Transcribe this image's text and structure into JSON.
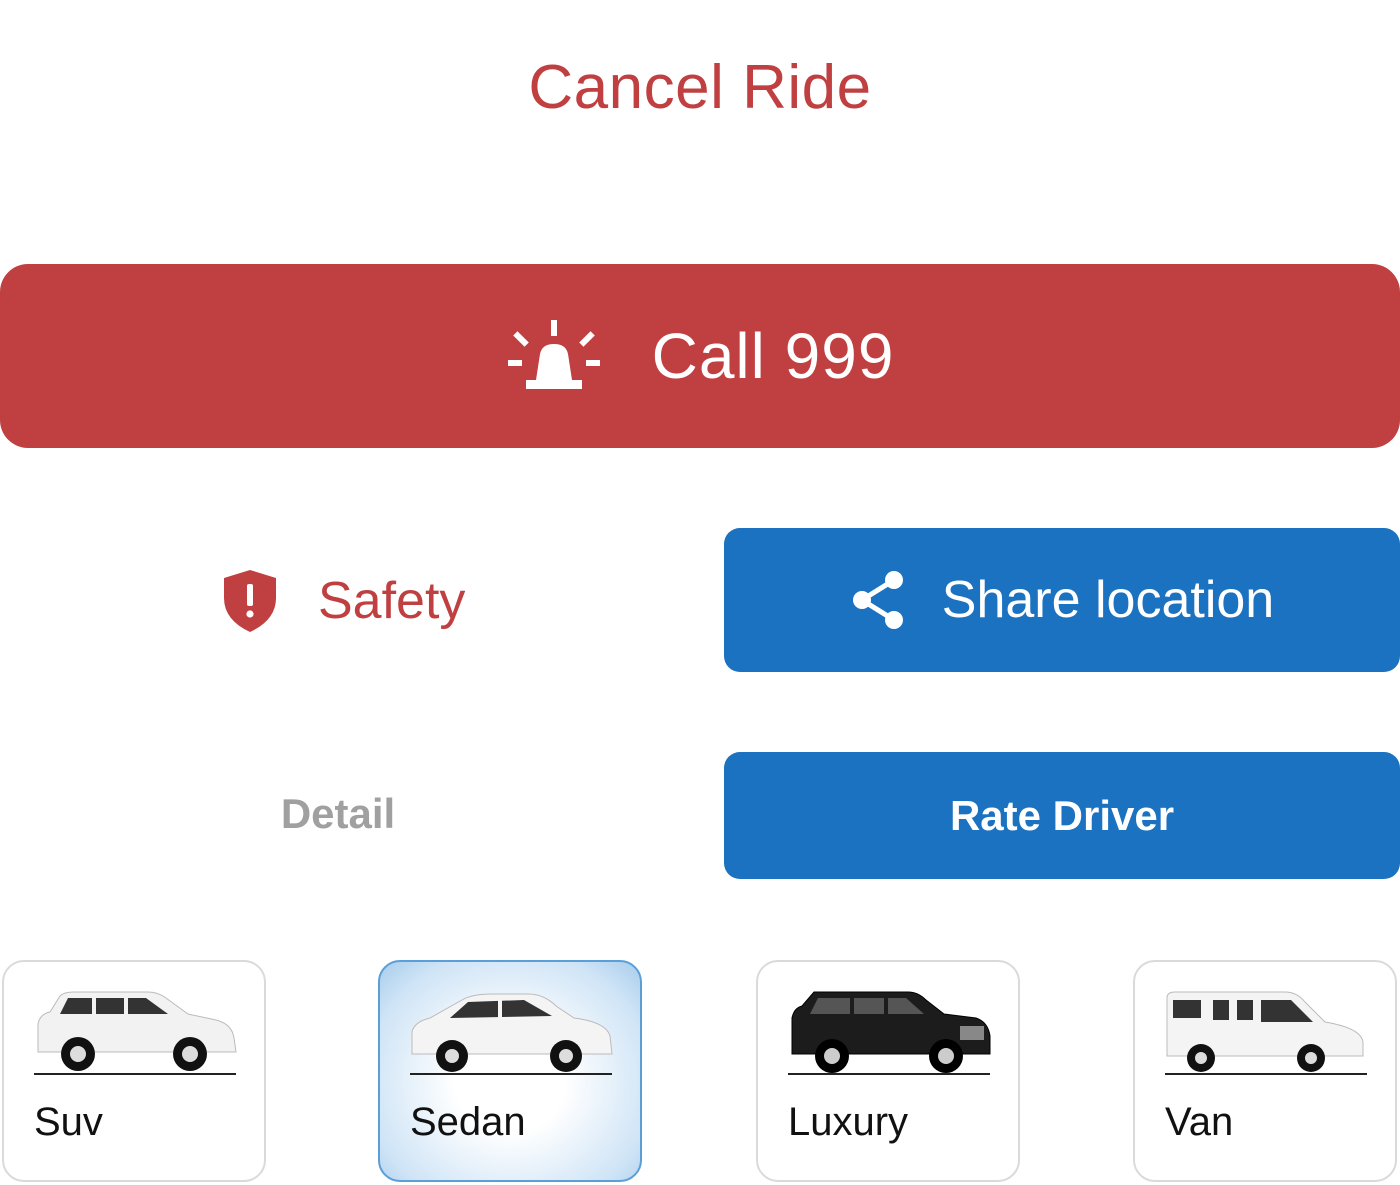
{
  "header": {
    "cancel_label": "Cancel Ride"
  },
  "emergency": {
    "label": "Call 999",
    "icon": "siren-icon",
    "color": "#c04041"
  },
  "safety": {
    "label": "Safety",
    "icon": "shield-alert-icon"
  },
  "share": {
    "label": "Share location",
    "icon": "share-icon",
    "color": "#1b72c0"
  },
  "detail": {
    "label": "Detail"
  },
  "rate": {
    "label": "Rate Driver"
  },
  "vehicles": {
    "selected": "Sedan",
    "items": [
      {
        "label": "Suv",
        "icon": "suv-car-icon"
      },
      {
        "label": "Sedan",
        "icon": "sedan-car-icon"
      },
      {
        "label": "Luxury",
        "icon": "luxury-suv-icon"
      },
      {
        "label": "Van",
        "icon": "van-icon"
      }
    ]
  }
}
